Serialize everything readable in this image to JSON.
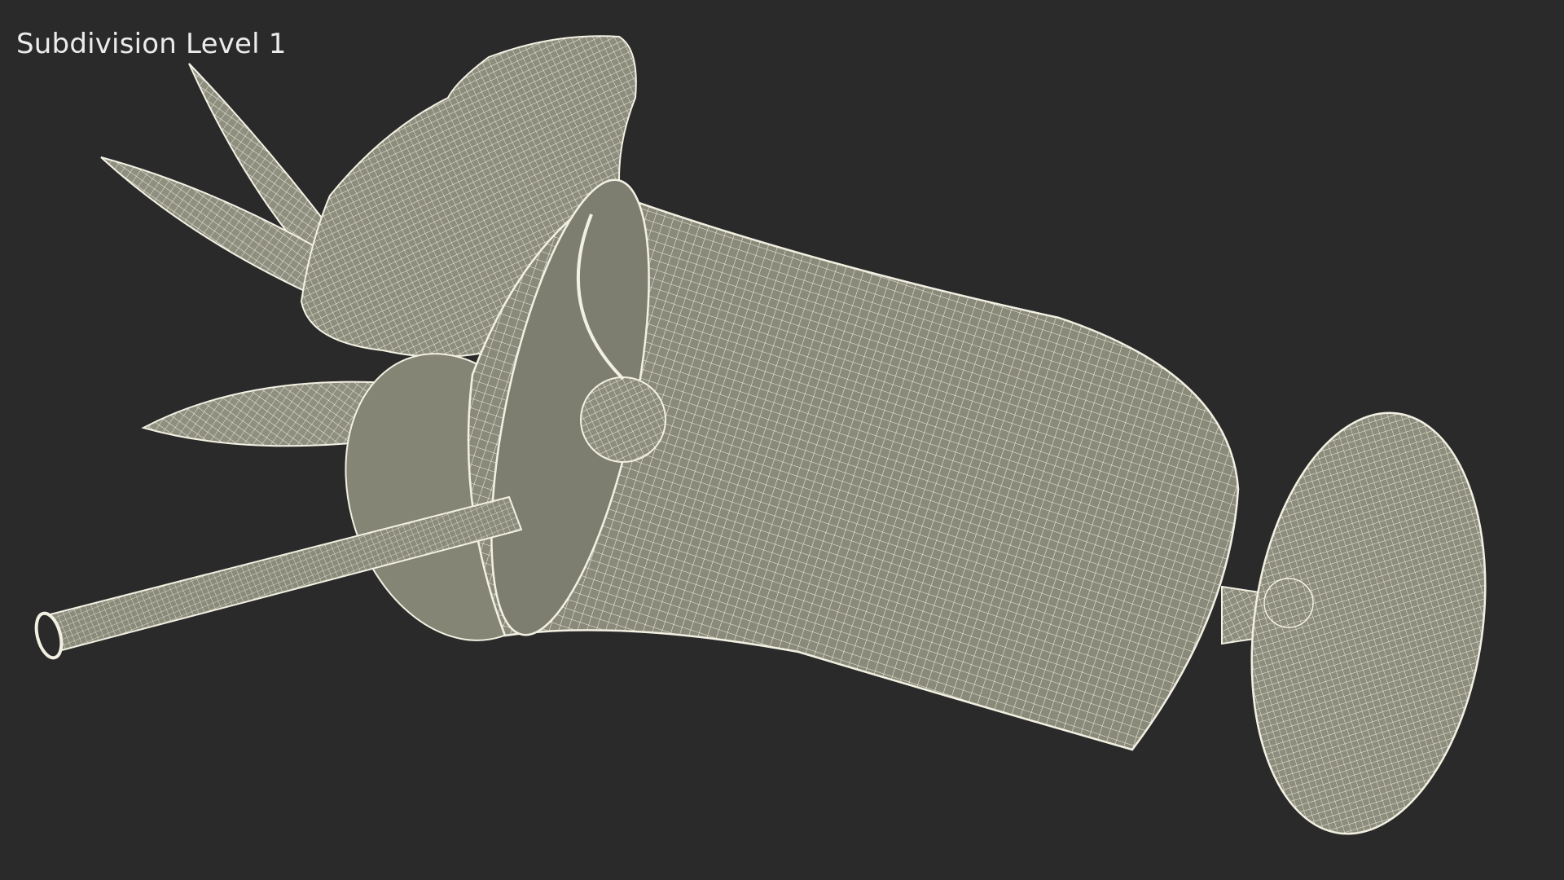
{
  "viewport": {
    "label": "Subdivision Level 1",
    "background": "#2a2a2a",
    "mesh_fill": "#8c8c7c",
    "mesh_line": "#f2f0e2"
  },
  "model": {
    "name": "cocktail glass with leaves, straw and cherry",
    "render_mode": "wireframe"
  }
}
